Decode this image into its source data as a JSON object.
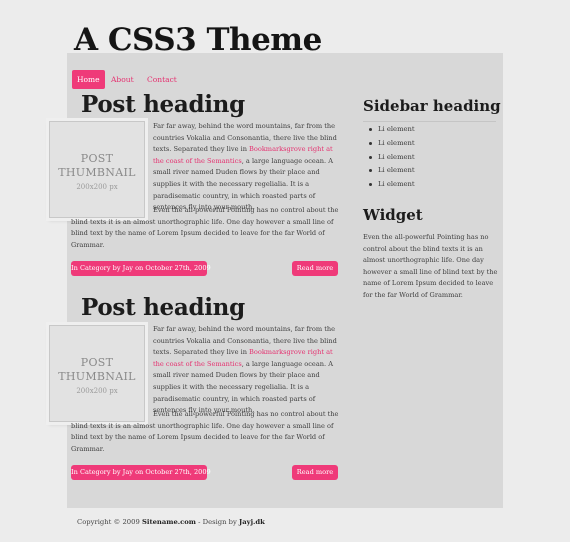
{
  "site": {
    "title": "A CSS3 Theme"
  },
  "nav": {
    "items": [
      {
        "label": "Home",
        "active": true
      },
      {
        "label": "About",
        "active": false
      },
      {
        "label": "Contact",
        "active": false
      }
    ]
  },
  "posts": [
    {
      "heading": "Post heading",
      "thumb": {
        "line1": "POST",
        "line2": "THUMBNAIL",
        "size": "200x200 px"
      },
      "p1_before": "Far far away, behind the word mountains, far from the countries Vokalia and Consonantia, there live the blind texts. Separated they live in ",
      "p1_link": "Bookmarksgrove right at the coast of the Semantics",
      "p1_after": ", a large language ocean. A small river named Duden flows by their place and supplies it with the necessary regelialia. It is a paradisematic country, in which roasted parts of sentences fly into your mouth.",
      "p2": "Even the all-powerful Pointing has no control about the blind texts it is an almost unorthographic life. One day however a small line of blind text by the name of Lorem Ipsum decided to leave for the far World of Grammar.",
      "meta": "In Category by Jay on October 27th, 2009",
      "more": "Read more"
    },
    {
      "heading": "Post heading",
      "thumb": {
        "line1": "POST",
        "line2": "THUMBNAIL",
        "size": "200x200 px"
      },
      "p1_before": "Far far away, behind the word mountains, far from the countries Vokalia and Consonantia, there live the blind texts. Separated they live in ",
      "p1_link": "Bookmarksgrove right at the coast of the Semantics",
      "p1_after": ", a large language ocean. A small river named Duden flows by their place and supplies it with the necessary regelialia. It is a paradisematic country, in which roasted parts of sentences fly into your mouth.",
      "p2": "Even the all-powerful Pointing has no control about the blind texts it is an almost unorthographic life. One day however a small line of blind text by the name of Lorem Ipsum decided to leave for the far World of Grammar.",
      "meta": "In Category by Jay on October 27th, 2009",
      "more": "Read more"
    }
  ],
  "sidebar": {
    "heading": "Sidebar heading",
    "items": [
      "Li element",
      "Li element",
      "Li element",
      "Li element",
      "Li element"
    ],
    "widget_heading": "Widget",
    "widget_text": "Even the all-powerful Pointing has no control about the blind texts it is an almost unorthographic life. One day however a small line of blind text by the name of Lorem Ipsum decided to leave for the far World of Grammar."
  },
  "footer": {
    "copyright": "Copyright © 2009 ",
    "site_name": "Sitename.com",
    "design_by": " - Design by ",
    "designer": "Jayj.dk"
  },
  "colors": {
    "accent": "#ef3a79",
    "link": "#e5306f",
    "panel": "#d8d8d8",
    "page": "#ececec"
  }
}
